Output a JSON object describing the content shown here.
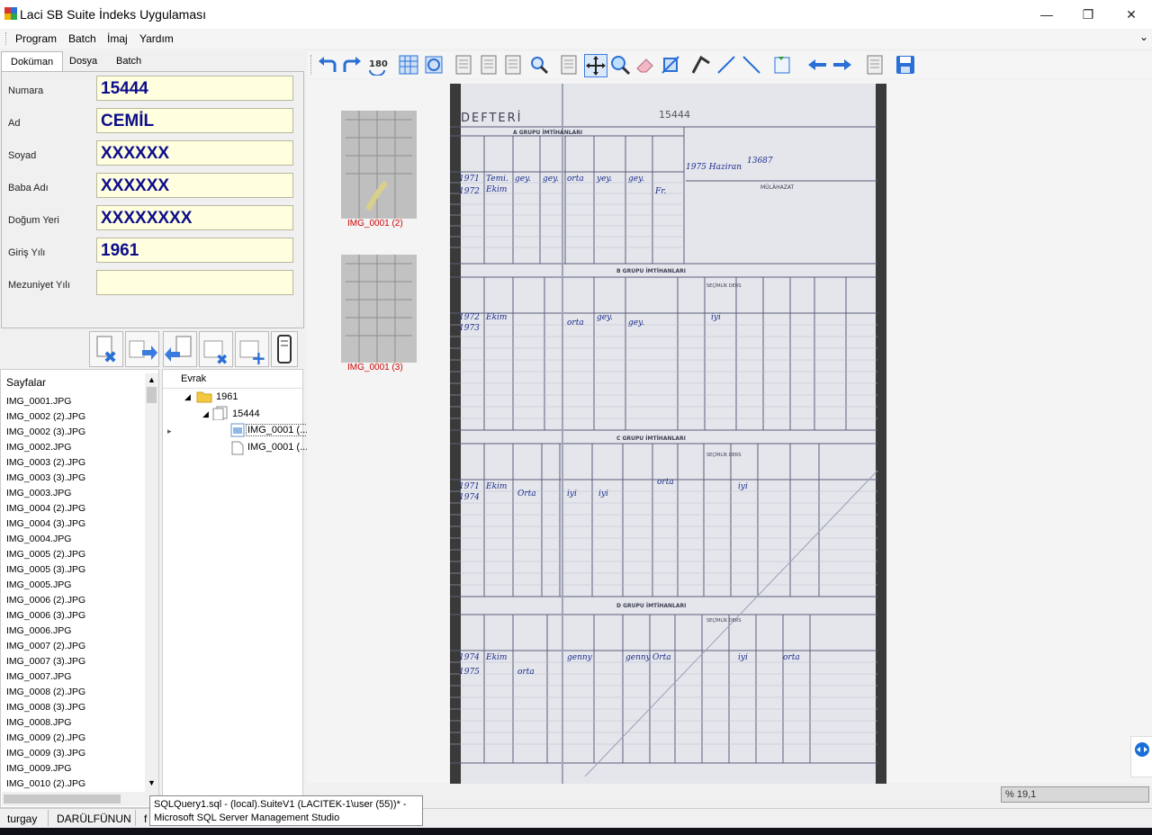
{
  "window": {
    "title": "Laci SB Suite İndeks Uygulaması",
    "minimize": "—",
    "maximize": "❐",
    "close": "✕"
  },
  "menu": [
    "Program",
    "Batch",
    "İmaj",
    "Yardım"
  ],
  "left_tabs": [
    "Doküman",
    "Dosya",
    "Batch"
  ],
  "form": {
    "fields": [
      {
        "label": "Numara",
        "value": "15444"
      },
      {
        "label": "Ad",
        "value": "CEMİL"
      },
      {
        "label": "Soyad",
        "value": "XXXXXX"
      },
      {
        "label": "Baba Adı",
        "value": "XXXXXX"
      },
      {
        "label": "Doğum Yeri",
        "value": "XXXXXXXX"
      },
      {
        "label": "Giriş Yılı",
        "value": "1961"
      },
      {
        "label": "Mezuniyet Yılı",
        "value": ""
      }
    ]
  },
  "pages": {
    "header": "Sayfalar",
    "items": [
      "IMG_0001.JPG",
      "IMG_0002 (2).JPG",
      "IMG_0002 (3).JPG",
      "IMG_0002.JPG",
      "IMG_0003 (2).JPG",
      "IMG_0003 (3).JPG",
      "IMG_0003.JPG",
      "IMG_0004 (2).JPG",
      "IMG_0004 (3).JPG",
      "IMG_0004.JPG",
      "IMG_0005 (2).JPG",
      "IMG_0005 (3).JPG",
      "IMG_0005.JPG",
      "IMG_0006 (2).JPG",
      "IMG_0006 (3).JPG",
      "IMG_0006.JPG",
      "IMG_0007 (2).JPG",
      "IMG_0007 (3).JPG",
      "IMG_0007.JPG",
      "IMG_0008 (2).JPG",
      "IMG_0008 (3).JPG",
      "IMG_0008.JPG",
      "IMG_0009 (2).JPG",
      "IMG_0009 (3).JPG",
      "IMG_0009.JPG",
      "IMG_0010 (2).JPG"
    ]
  },
  "tree": {
    "header": "Evrak",
    "folder": "1961",
    "doc": "15444",
    "files": [
      "IMG_0001 (...",
      "IMG_0001 (..."
    ]
  },
  "thumbnails": [
    "IMG_0001 (2)",
    "IMG_0001 (3)"
  ],
  "document": {
    "header": "DEFTERİ",
    "number": "15444",
    "sections": [
      "A GRUPU İMTİHANLARI",
      "B GRUPU İMTİHANLARI",
      "C GRUPU İMTİHANLARI",
      "D GRUPU İMTİHANLARI"
    ],
    "side_label": "MÜLÂHAZAT",
    "secimlik": "SEÇİMLİK DERS"
  },
  "zoom": "% 19,1",
  "status": [
    "turgay",
    "DARÜLFÜNUN",
    "f"
  ],
  "tooltip": [
    "SQLQuery1.sql - (local).SuiteV1 (LACITEK-1\\user (55))* -",
    "Microsoft SQL Server Management Studio"
  ]
}
